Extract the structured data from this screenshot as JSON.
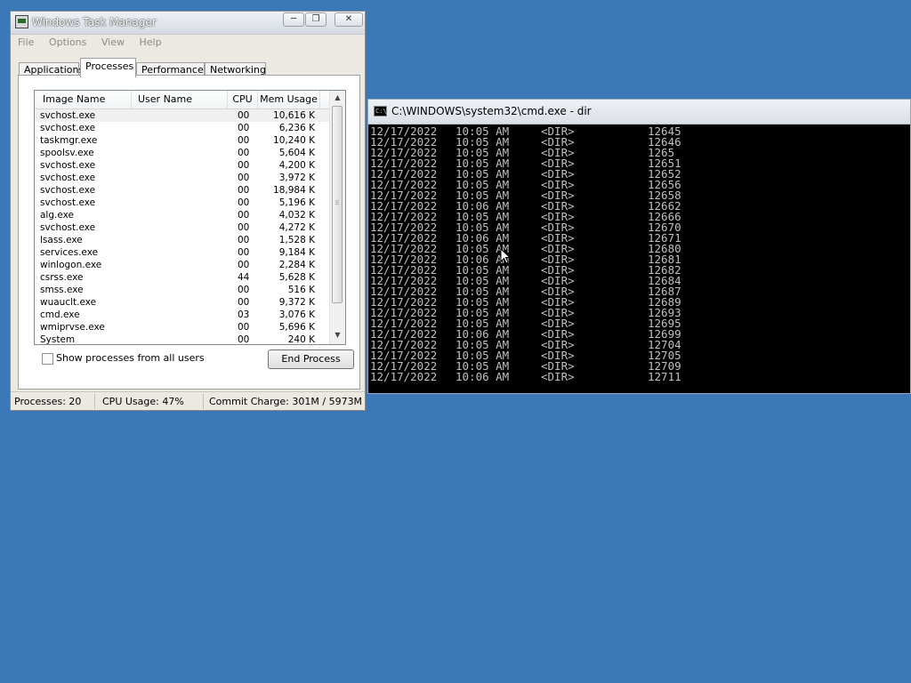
{
  "taskmgr": {
    "title": "Windows Task Manager",
    "menu": [
      "File",
      "Options",
      "View",
      "Help"
    ],
    "tabs": [
      "Applications",
      "Processes",
      "Performance",
      "Networking"
    ],
    "active_tab": "Processes",
    "columns": [
      "Image Name",
      "User Name",
      "CPU",
      "Mem Usage"
    ],
    "processes": [
      {
        "name": "svchost.exe",
        "user": "",
        "cpu": "00",
        "mem": "10,616 K"
      },
      {
        "name": "svchost.exe",
        "user": "",
        "cpu": "00",
        "mem": "6,236 K"
      },
      {
        "name": "taskmgr.exe",
        "user": "",
        "cpu": "00",
        "mem": "10,240 K"
      },
      {
        "name": "spoolsv.exe",
        "user": "",
        "cpu": "00",
        "mem": "5,604 K"
      },
      {
        "name": "svchost.exe",
        "user": "",
        "cpu": "00",
        "mem": "4,200 K"
      },
      {
        "name": "svchost.exe",
        "user": "",
        "cpu": "00",
        "mem": "3,972 K"
      },
      {
        "name": "svchost.exe",
        "user": "",
        "cpu": "00",
        "mem": "18,984 K"
      },
      {
        "name": "svchost.exe",
        "user": "",
        "cpu": "00",
        "mem": "5,196 K"
      },
      {
        "name": "alg.exe",
        "user": "",
        "cpu": "00",
        "mem": "4,032 K"
      },
      {
        "name": "svchost.exe",
        "user": "",
        "cpu": "00",
        "mem": "4,272 K"
      },
      {
        "name": "lsass.exe",
        "user": "",
        "cpu": "00",
        "mem": "1,528 K"
      },
      {
        "name": "services.exe",
        "user": "",
        "cpu": "00",
        "mem": "9,184 K"
      },
      {
        "name": "winlogon.exe",
        "user": "",
        "cpu": "00",
        "mem": "2,284 K"
      },
      {
        "name": "csrss.exe",
        "user": "",
        "cpu": "44",
        "mem": "5,628 K"
      },
      {
        "name": "smss.exe",
        "user": "",
        "cpu": "00",
        "mem": "516 K"
      },
      {
        "name": "wuauclt.exe",
        "user": "",
        "cpu": "00",
        "mem": "9,372 K"
      },
      {
        "name": "cmd.exe",
        "user": "",
        "cpu": "03",
        "mem": "3,076 K"
      },
      {
        "name": "wmiprvse.exe",
        "user": "",
        "cpu": "00",
        "mem": "5,696 K"
      },
      {
        "name": "System",
        "user": "",
        "cpu": "00",
        "mem": "240 K"
      }
    ],
    "show_all_users_label": "Show processes from all users",
    "end_process_label": "End Process",
    "status": {
      "processes": "Processes: 20",
      "cpu": "CPU Usage: 47%",
      "commit": "Commit Charge: 301M / 5973M"
    }
  },
  "cmd": {
    "title": "C:\\WINDOWS\\system32\\cmd.exe - dir",
    "lines": [
      {
        "date": "12/17/2022",
        "time": "10:05 AM",
        "type": "<DIR>",
        "name": "12645"
      },
      {
        "date": "12/17/2022",
        "time": "10:05 AM",
        "type": "<DIR>",
        "name": "12646"
      },
      {
        "date": "12/17/2022",
        "time": "10:05 AM",
        "type": "<DIR>",
        "name": "1265"
      },
      {
        "date": "12/17/2022",
        "time": "10:05 AM",
        "type": "<DIR>",
        "name": "12651"
      },
      {
        "date": "12/17/2022",
        "time": "10:05 AM",
        "type": "<DIR>",
        "name": "12652"
      },
      {
        "date": "12/17/2022",
        "time": "10:05 AM",
        "type": "<DIR>",
        "name": "12656"
      },
      {
        "date": "12/17/2022",
        "time": "10:05 AM",
        "type": "<DIR>",
        "name": "12658"
      },
      {
        "date": "12/17/2022",
        "time": "10:06 AM",
        "type": "<DIR>",
        "name": "12662"
      },
      {
        "date": "12/17/2022",
        "time": "10:05 AM",
        "type": "<DIR>",
        "name": "12666"
      },
      {
        "date": "12/17/2022",
        "time": "10:05 AM",
        "type": "<DIR>",
        "name": "12670"
      },
      {
        "date": "12/17/2022",
        "time": "10:06 AM",
        "type": "<DIR>",
        "name": "12671"
      },
      {
        "date": "12/17/2022",
        "time": "10:05 AM",
        "type": "<DIR>",
        "name": "12680"
      },
      {
        "date": "12/17/2022",
        "time": "10:06 AM",
        "type": "<DIR>",
        "name": "12681"
      },
      {
        "date": "12/17/2022",
        "time": "10:05 AM",
        "type": "<DIR>",
        "name": "12682"
      },
      {
        "date": "12/17/2022",
        "time": "10:05 AM",
        "type": "<DIR>",
        "name": "12684"
      },
      {
        "date": "12/17/2022",
        "time": "10:05 AM",
        "type": "<DIR>",
        "name": "12687"
      },
      {
        "date": "12/17/2022",
        "time": "10:05 AM",
        "type": "<DIR>",
        "name": "12689"
      },
      {
        "date": "12/17/2022",
        "time": "10:05 AM",
        "type": "<DIR>",
        "name": "12693"
      },
      {
        "date": "12/17/2022",
        "time": "10:05 AM",
        "type": "<DIR>",
        "name": "12695"
      },
      {
        "date": "12/17/2022",
        "time": "10:06 AM",
        "type": "<DIR>",
        "name": "12699"
      },
      {
        "date": "12/17/2022",
        "time": "10:05 AM",
        "type": "<DIR>",
        "name": "12704"
      },
      {
        "date": "12/17/2022",
        "time": "10:05 AM",
        "type": "<DIR>",
        "name": "12705"
      },
      {
        "date": "12/17/2022",
        "time": "10:05 AM",
        "type": "<DIR>",
        "name": "12709"
      },
      {
        "date": "12/17/2022",
        "time": "10:06 AM",
        "type": "<DIR>",
        "name": "12711"
      }
    ]
  },
  "colors": {
    "desktop": "#3a78b8",
    "console_bg": "#000000",
    "console_fg": "#c0c0c0"
  }
}
